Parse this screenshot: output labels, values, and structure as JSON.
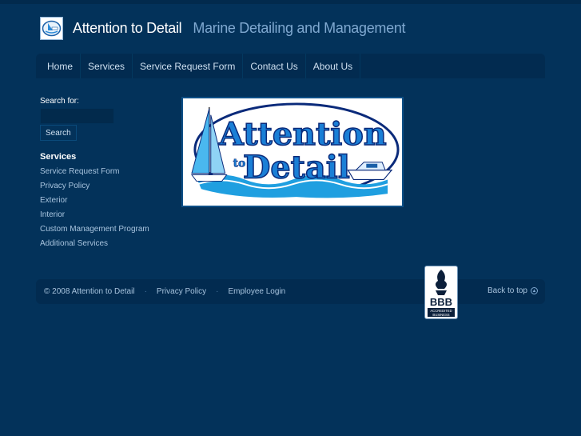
{
  "header": {
    "title": "Attention to Detail",
    "tagline": "Marine Detailing and Management"
  },
  "nav": {
    "items": [
      {
        "label": "Home"
      },
      {
        "label": "Services"
      },
      {
        "label": "Service Request Form"
      },
      {
        "label": "Contact Us"
      },
      {
        "label": "About Us"
      }
    ]
  },
  "sidebar": {
    "search_label": "Search for:",
    "search_value": "",
    "search_button": "Search",
    "heading": "Services",
    "links": [
      {
        "label": "Service Request Form"
      },
      {
        "label": "Privacy Policy"
      },
      {
        "label": "Exterior"
      },
      {
        "label": "Interior"
      },
      {
        "label": "Custom Management Program"
      },
      {
        "label": "Additional Services"
      }
    ]
  },
  "banner": {
    "line1": "Attention",
    "line2": "to",
    "line3": "Detail"
  },
  "bbb": {
    "mark": "BBB",
    "caption1": "ACCREDITED",
    "caption2": "BUSINESS"
  },
  "footer": {
    "copyright": "© 2008 Attention to Detail",
    "privacy": "Privacy Policy",
    "employee": "Employee Login",
    "back_to_top": "Back to top",
    "separator": "·"
  },
  "colors": {
    "background": "#03325a",
    "nav_bg": "#022b50",
    "title": "#ffffff",
    "tagline": "#7fa8d0",
    "link": "#a8c4de",
    "banner_text": "#1a7fd6",
    "banner_outline": "#0a2a7a"
  }
}
